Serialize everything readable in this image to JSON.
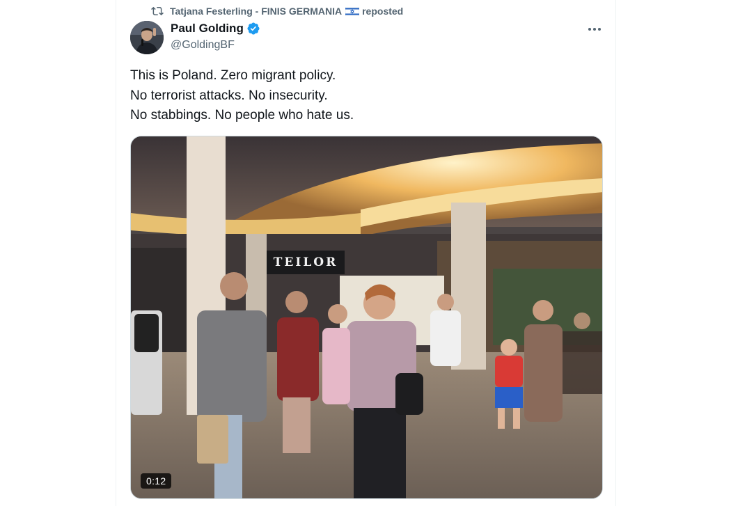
{
  "repost": {
    "icon": "repost-icon",
    "user": "Tatjana Festerling - FINIS GERMANIA",
    "flag": "israel-flag-icon",
    "label": "reposted"
  },
  "author": {
    "name": "Paul Golding",
    "verified_icon": "verified-badge-icon",
    "verified_color": "#1d9bf0",
    "handle": "@GoldingBF"
  },
  "tweet": {
    "lines": [
      "This is Poland. Zero migrant policy.",
      "No terrorist attacks. No insecurity.",
      "No stabbings. No people who hate us."
    ]
  },
  "media": {
    "type": "video",
    "store_sign": "TEILOR",
    "duration": "0:12"
  },
  "colors": {
    "text_primary": "#0f1419",
    "text_secondary": "#536471",
    "border": "#cfd9de"
  }
}
